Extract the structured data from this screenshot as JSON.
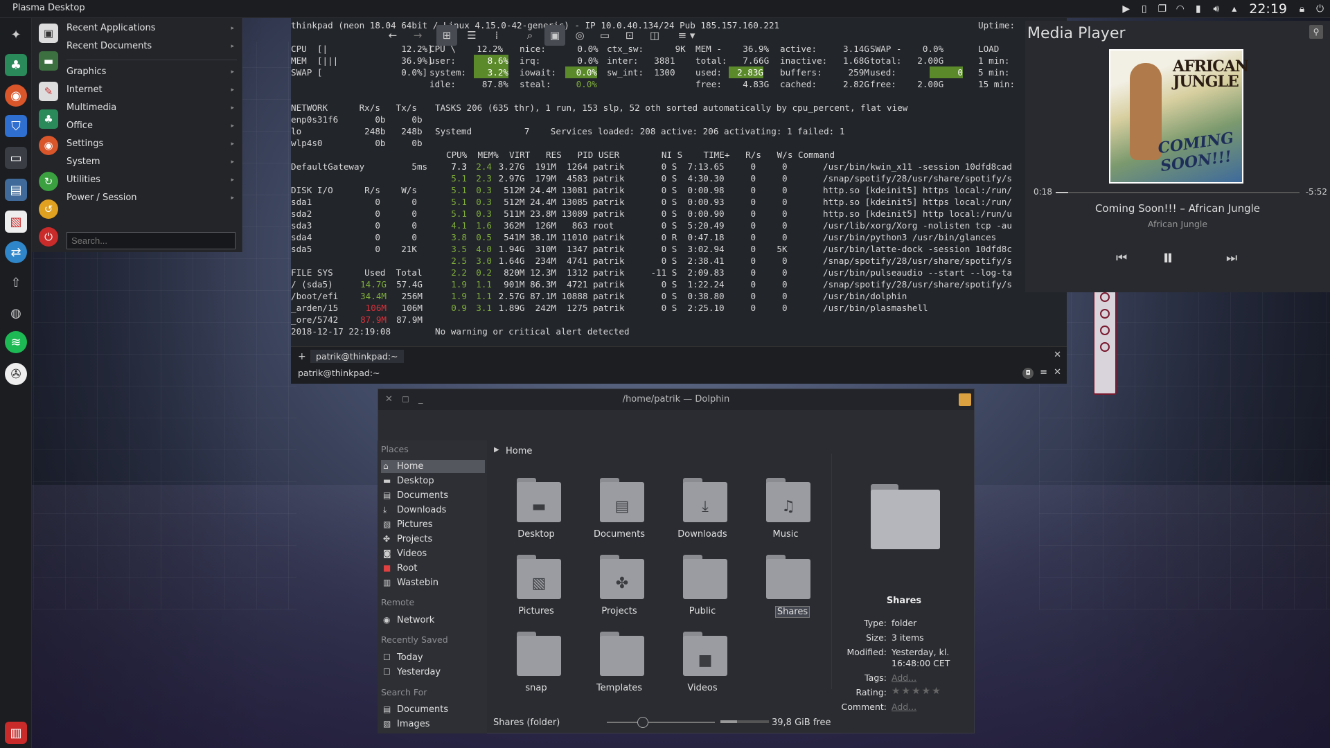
{
  "panel": {
    "title": "Plasma Desktop",
    "clock": "22:19"
  },
  "menu": {
    "items": [
      {
        "label": "Recent Applications"
      },
      {
        "label": "Recent Documents"
      },
      {
        "label": "Graphics"
      },
      {
        "label": "Internet"
      },
      {
        "label": "Multimedia"
      },
      {
        "label": "Office"
      },
      {
        "label": "Settings"
      },
      {
        "label": "System"
      },
      {
        "label": "Utilities"
      },
      {
        "label": "Power / Session"
      }
    ],
    "search_placeholder": "Search..."
  },
  "terminal": {
    "header": "thinkpad (neon 18.04 64bit / Linux 4.15.0-42-generic) - IP 10.0.40.134/24 Pub 185.157.160.221",
    "uptime_label": "Uptime:",
    "cpu_bar": "CPU  [|              12.2%]",
    "mem_bar": "MEM  [|||            36.9%]",
    "swap_bar": "SWAP [               0.0%]",
    "cpu_col": "CPU \\    12.2%",
    "user_l": "user:",
    "user_v": "8.6%",
    "system_l": "system:",
    "system_v": "3.2%",
    "idle": "idle:     87.8%",
    "nice": "nice:      0.0%",
    "irq": "irq:       0.0%",
    "iowait_l": "iowait:",
    "iowait_v": "0.0%",
    "steal_l": "steal:",
    "steal_v": "0.0%",
    "ctx": "ctx_sw:      9K",
    "inter": "inter:   3881",
    "sw_int": "sw_int:  1300",
    "mem_col": "MEM -    36.9%",
    "mem_total": "total:   7.66G",
    "mem_used_l": "used:",
    "mem_used_v": "2.83G",
    "mem_free": "free:    4.83G",
    "active": "active:     3.14G",
    "inactive": "inactive:   1.68G",
    "buffers": "buffers:     259M",
    "cached": "cached:     2.82G",
    "swap_col": "SWAP -    0.0%",
    "swap_total": "total:   2.00G",
    "swap_used_l": "used:",
    "swap_used_v": "0",
    "swap_free": "free:    2.00G",
    "load": "LOAD",
    "load1": "1 min:",
    "load5": "5 min:",
    "load15": "15 min:",
    "network": "NETWORK      Rx/s   Tx/s",
    "net1": "enp0s31f6       0b     0b",
    "net2": "lo            248b   248b",
    "net3": "wlp4s0          0b     0b",
    "gateway": "DefaultGateway         5ms",
    "tasks": "TASKS 206 (635 thr), 1 run, 153 slp, 52 oth sorted automatically by cpu_percent, flat view",
    "systemd": "Systemd          7    Services loaded: 208 active: 206 activating: 1 failed: 1",
    "diskhdr": "DISK I/O      R/s    W/s",
    "disks": [
      "sda1            0      0",
      "sda2            0      0",
      "sda3            0      0",
      "sda4            0      0",
      "sda5            0    21K"
    ],
    "fshdr": "FILE SYS      Used  Total",
    "fs": [
      {
        "name": "/ (sda5)",
        "used": "14.7G",
        "total": "57.4G",
        "cls": "gr"
      },
      {
        "name": "/boot/efi",
        "used": "34.4M",
        "total": "256M",
        "cls": "gr"
      },
      {
        "name": "_arden/15",
        "used": "106M",
        "total": "106M",
        "cls": "red"
      },
      {
        "name": "_ore/5742",
        "used": "87.9M",
        "total": "87.9M",
        "cls": "red"
      }
    ],
    "timestamp": "2018-12-17 22:19:08",
    "alert": "No warning or critical alert detected",
    "prochdr": "CPU%  MEM%  VIRT   RES   PID USER        NI S    TIME+   R/s   W/s Command",
    "procs": [
      {
        "cpu": "7.3",
        "mem": "2.4",
        "rest": " 3.27G  191M  1264 patrik       0 S  7:13.65     0     0",
        "cmd": "/usr/bin/kwin_x11 -session 10dfd8cad"
      },
      {
        "cpu": "5.1",
        "mem": "2.3",
        "rest": " 2.97G  179M  4583 patrik       0 S  4:30.30     0     0",
        "cmd": "/snap/spotify/28/usr/share/spotify/s"
      },
      {
        "cpu": "5.1",
        "mem": "0.3",
        "rest": "  512M 24.4M 13081 patrik       0 S  0:00.98     0     0",
        "cmd": "http.so [kdeinit5] https local:/run/"
      },
      {
        "cpu": "5.1",
        "mem": "0.3",
        "rest": "  512M 24.4M 13085 patrik       0 S  0:00.93     0     0",
        "cmd": "http.so [kdeinit5] https local:/run/"
      },
      {
        "cpu": "5.1",
        "mem": "0.3",
        "rest": "  511M 23.8M 13089 patrik       0 S  0:00.90     0     0",
        "cmd": "http.so [kdeinit5] http local:/run/u"
      },
      {
        "cpu": "4.1",
        "mem": "1.6",
        "rest": "  362M  126M   863 root         0 S  5:20.49     0     0",
        "cmd": "/usr/lib/xorg/Xorg -nolisten tcp -au"
      },
      {
        "cpu": "3.8",
        "mem": "0.5",
        "rest": "  541M 38.1M 11010 patrik       0 R  0:47.18     0     0",
        "cmd": "/usr/bin/python3 /usr/bin/glances"
      },
      {
        "cpu": "3.5",
        "mem": "4.0",
        "rest": " 1.94G  310M  1347 patrik       0 S  3:02.94     0    5K",
        "cmd": "/usr/bin/latte-dock -session 10dfd8c"
      },
      {
        "cpu": "2.5",
        "mem": "3.0",
        "rest": " 1.64G  234M  4741 patrik       0 S  2:38.41     0     0",
        "cmd": "/snap/spotify/28/usr/share/spotify/s"
      },
      {
        "cpu": "2.2",
        "mem": "0.2",
        "rest": "  820M 12.3M  1312 patrik     -11 S  2:09.83     0     0",
        "cmd": "/usr/bin/pulseaudio --start --log-ta"
      },
      {
        "cpu": "1.9",
        "mem": "1.1",
        "rest": "  901M 86.3M  4721 patrik       0 S  1:22.24     0     0",
        "cmd": "/snap/spotify/28/usr/share/spotify/s"
      },
      {
        "cpu": "1.9",
        "mem": "1.1",
        "rest": " 2.57G 87.1M 10888 patrik       0 S  0:38.80     0     0",
        "cmd": "/usr/bin/dolphin"
      },
      {
        "cpu": "0.9",
        "mem": "3.1",
        "rest": " 1.89G  242M  1275 patrik       0 S  2:25.10     0     0",
        "cmd": "/usr/bin/plasmashell"
      }
    ],
    "tab": "patrik@thinkpad:~",
    "title": "patrik@thinkpad:~"
  },
  "media": {
    "title": "Media Player",
    "album_text": "AFRICAN JUNGLE",
    "album_coming": "COMING SOON!!!",
    "time_elapsed": "0:18",
    "time_remaining": "-5:52",
    "progress": 0.05,
    "track": "Coming Soon!!! – African Jungle",
    "artist": "African Jungle"
  },
  "dolphin": {
    "title": "/home/patrik — Dolphin",
    "breadcrumb": "Home",
    "places_header": "Places",
    "places": [
      {
        "label": "Home",
        "icon": "home-icon"
      },
      {
        "label": "Desktop",
        "icon": "desktop-icon"
      },
      {
        "label": "Documents",
        "icon": "document-icon"
      },
      {
        "label": "Downloads",
        "icon": "download-icon"
      },
      {
        "label": "Pictures",
        "icon": "picture-icon"
      },
      {
        "label": "Projects",
        "icon": "projects-icon"
      },
      {
        "label": "Videos",
        "icon": "video-icon"
      },
      {
        "label": "Root",
        "icon": "root-icon"
      },
      {
        "label": "Wastebin",
        "icon": "trash-icon"
      }
    ],
    "remote_header": "Remote",
    "network": "Network",
    "recent_header": "Recently Saved",
    "today": "Today",
    "yesterday": "Yesterday",
    "search_header": "Search For",
    "search_docs": "Documents",
    "search_images": "Images",
    "folders": [
      "Desktop",
      "Documents",
      "Downloads",
      "Music",
      "Pictures",
      "Projects",
      "Public",
      "Shares",
      "snap",
      "Templates",
      "Videos"
    ],
    "info": {
      "name": "Shares",
      "type_label": "Type:",
      "type": "folder",
      "size_label": "Size:",
      "size": "3 items",
      "modified_label": "Modified:",
      "modified": "Yesterday, kl. 16:48:00 CET",
      "tags_label": "Tags:",
      "tags": "Add...",
      "rating_label": "Rating:",
      "comment_label": "Comment:",
      "comment": "Add..."
    },
    "status": "Shares (folder)",
    "free": "39,8 GiB free"
  }
}
